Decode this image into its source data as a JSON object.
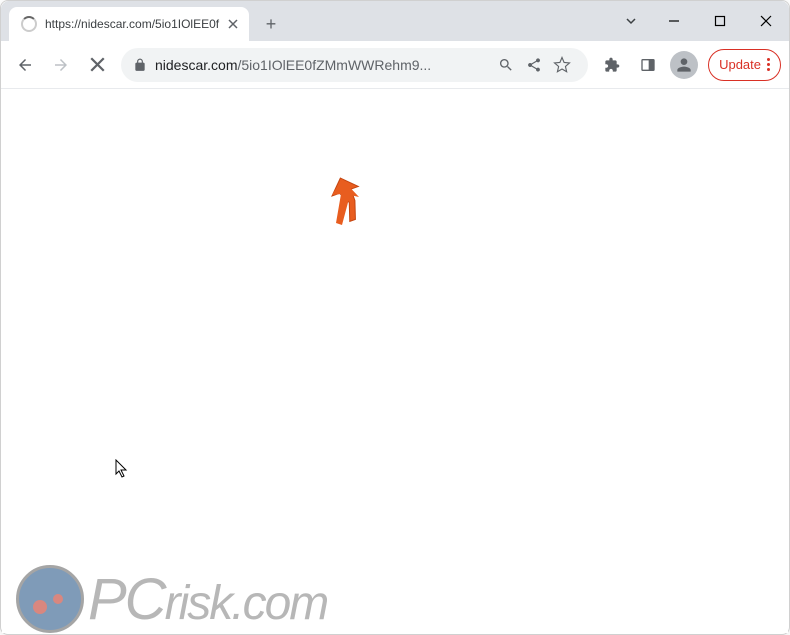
{
  "tab": {
    "title": "https://nidescar.com/5io1IOlEE0f",
    "close_label": "✕"
  },
  "window": {
    "new_tab_label": "+"
  },
  "address": {
    "domain": "nidescar.com",
    "path": "/5io1IOlEE0fZMmWWRehm9..."
  },
  "toolbar": {
    "update_label": "Update"
  },
  "watermark": {
    "text_pc": "PC",
    "text_rest": "risk.com"
  }
}
